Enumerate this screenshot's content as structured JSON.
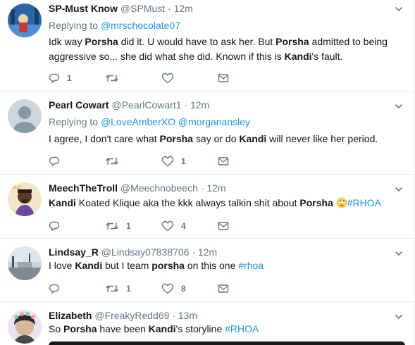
{
  "tweets": [
    {
      "name": "SP-Must Know",
      "handle": "@SPMust",
      "dot": "·",
      "time": "12m",
      "replying_label": "Replying to",
      "replying_to": [
        "@mrschocolate07"
      ],
      "text_parts": [
        {
          "t": "Idk way "
        },
        {
          "t": "Porsha",
          "b": true
        },
        {
          "t": " did it. U would have to ask her.  But "
        },
        {
          "t": "Porsha",
          "b": true
        },
        {
          "t": " admitted to being aggressive so...  she did what she did.  Known if this is "
        },
        {
          "t": "Kandi",
          "b": true
        },
        {
          "t": "'s fault."
        }
      ],
      "replies": "1",
      "retweets": "",
      "likes": ""
    },
    {
      "name": "Pearl Cowart",
      "handle": "@PearlCowart1",
      "dot": "·",
      "time": "12m",
      "replying_label": "Replying to",
      "replying_to": [
        "@LoveAmberXO",
        "@morganansley"
      ],
      "text_parts": [
        {
          "t": "I agree, I don't care what "
        },
        {
          "t": "Porsha",
          "b": true
        },
        {
          "t": " say or do "
        },
        {
          "t": "Kandi",
          "b": true
        },
        {
          "t": " will never like her period."
        }
      ],
      "replies": "",
      "retweets": "",
      "likes": "1"
    },
    {
      "name": "MeechTheTroll",
      "handle": "@Meechnobeech",
      "dot": "·",
      "time": "12m",
      "text_parts": [
        {
          "t": "Kandi",
          "b": true
        },
        {
          "t": " Koated Klique aka the kkk always talkin shit about "
        },
        {
          "t": "Porsha",
          "b": true
        },
        {
          "t": " "
        },
        {
          "emoji": "rolling-eyes-emoji"
        },
        {
          "t": "#RHOA",
          "tag": true
        }
      ],
      "replies": "",
      "retweets": "1",
      "likes": "4"
    },
    {
      "name": "Lindsay_R",
      "handle": "@Lindsay07838706",
      "dot": "·",
      "time": "12m",
      "text_parts": [
        {
          "t": "I love "
        },
        {
          "t": "Kandi",
          "b": true
        },
        {
          "t": " but I team "
        },
        {
          "t": "porsha",
          "b": true
        },
        {
          "t": " on this one "
        },
        {
          "t": "#rhoa",
          "tag": true
        }
      ],
      "replies": "",
      "retweets": "1",
      "likes": "8"
    },
    {
      "name": "Elizabeth",
      "handle": "@FreakyRedd69",
      "dot": "·",
      "time": "13m",
      "text_parts": [
        {
          "t": "So "
        },
        {
          "t": "Porsha",
          "b": true
        },
        {
          "t": " have been "
        },
        {
          "t": "Kandi",
          "b": true
        },
        {
          "t": "'s storyline "
        },
        {
          "t": "#RHOA",
          "tag": true
        }
      ]
    }
  ],
  "icons": {
    "reply": "reply-icon",
    "retweet": "retweet-icon",
    "like": "heart-icon",
    "dm": "envelope-icon",
    "more": "chevron-down-icon"
  },
  "colors": {
    "link": "#1b95e0",
    "muted": "#657786",
    "text": "#14171a",
    "divider": "#e6ecf0"
  }
}
